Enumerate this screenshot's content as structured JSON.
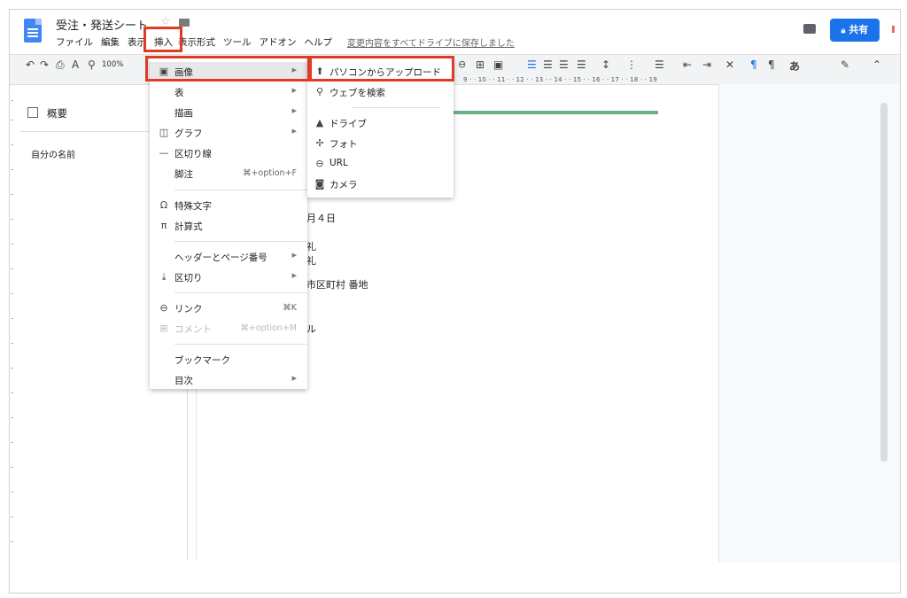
{
  "app": {
    "doc_title": "受注・発送シート",
    "menu_bar": [
      "ファイル",
      "編集",
      "表示",
      "挿入",
      "表示形式",
      "ツール",
      "アドオン",
      "ヘルプ"
    ],
    "save_status": "変更内容をすべてドライブに保存しました",
    "share_label": "共有",
    "zoom": "100%"
  },
  "toolbar": {
    "ruler_numbers": "9 · · 10 · · 11 · · 12 · · 13 · · 14 · · 15 · · 16 · · 17 · · 18 · · 19",
    "text_style": "あ"
  },
  "outline": {
    "title": "概要",
    "items": [
      "自分の名前"
    ]
  },
  "document": {
    "fragments": [
      "月４日",
      "礼",
      "礼",
      "市区町村 番地",
      "ル"
    ]
  },
  "insert_menu": {
    "items": [
      {
        "label": "画像",
        "icon": "image-icon",
        "submenu": true
      },
      {
        "label": "表",
        "submenu": true
      },
      {
        "label": "描画",
        "submenu": true
      },
      {
        "label": "グラフ",
        "icon": "chart-icon",
        "submenu": true
      },
      {
        "label": "区切り線",
        "icon": "horizontal-line-icon"
      },
      {
        "label": "脚注",
        "shortcut": "⌘+option+F"
      },
      {
        "label": "特殊文字",
        "icon": "omega-icon"
      },
      {
        "label": "計算式",
        "icon": "pi-icon"
      },
      {
        "label": "ヘッダーとページ番号",
        "submenu": true
      },
      {
        "label": "区切り",
        "icon": "page-break-icon",
        "submenu": true
      },
      {
        "label": "リンク",
        "icon": "link-icon",
        "shortcut": "⌘K"
      },
      {
        "label": "コメント",
        "icon": "comment-add-icon",
        "shortcut": "⌘+option+M",
        "disabled": true
      },
      {
        "label": "ブックマーク"
      },
      {
        "label": "目次",
        "submenu": true
      }
    ]
  },
  "image_submenu": {
    "items": [
      {
        "label": "パソコンからアップロード",
        "icon": "upload-icon"
      },
      {
        "label": "ウェブを検索",
        "icon": "search-icon"
      },
      {
        "label": "ドライブ",
        "icon": "drive-icon"
      },
      {
        "label": "フォト",
        "icon": "photos-icon"
      },
      {
        "label": "URL",
        "icon": "link-icon"
      },
      {
        "label": "カメラ",
        "icon": "camera-icon"
      }
    ]
  },
  "colors": {
    "share_button": "#1a73e8",
    "highlight_box": "#e03b24",
    "heading_rule": "#6ab187"
  }
}
